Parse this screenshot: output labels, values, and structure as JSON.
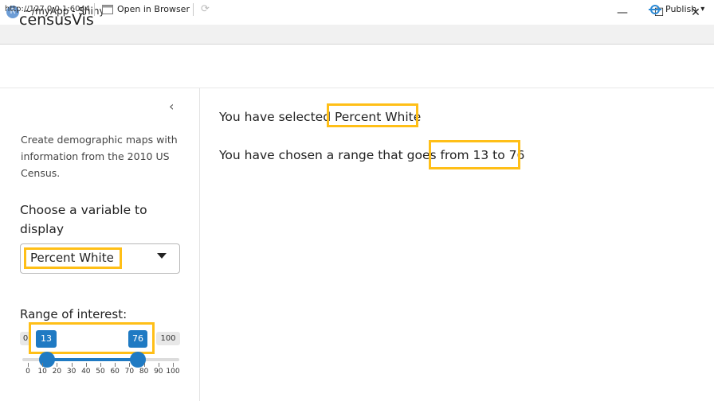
{
  "window": {
    "icon_letter": "R",
    "title": "~/myApp - Shiny",
    "minimize_glyph": "—",
    "maximize_glyph": "☐",
    "close_glyph": "✕"
  },
  "toolbar": {
    "url": "http://127.0.0.1:6044",
    "open_in_browser": "Open in Browser",
    "publish": "Publish",
    "publish_caret": "▾"
  },
  "app": {
    "title": "censusVis"
  },
  "sidebar": {
    "collapse_glyph": "‹",
    "description": "Create demographic maps with information from the 2010 US Census.",
    "select_label": "Choose a variable to display",
    "select_value": "Percent White",
    "range_label": "Range of interest:",
    "range_min_label": "0",
    "range_max_label": "100",
    "range_low": "13",
    "range_high": "76",
    "range_low_value": 13,
    "range_high_value": 76,
    "ticks": [
      "0",
      "10",
      "20",
      "30",
      "40",
      "50",
      "60",
      "70",
      "80",
      "90",
      "100"
    ]
  },
  "main": {
    "selected_prefix": "You have selected",
    "selected_value": "Percent White",
    "range_prefix": "You have chosen a range that goes",
    "range_value": "from 13 to 76"
  },
  "colors": {
    "accent": "#1f7ac3",
    "highlight": "#ffbf17"
  },
  "icons": {
    "app": "r-logo-icon",
    "open_in_browser": "browser-icon",
    "refresh": "refresh-icon",
    "publish": "publish-icon",
    "collapse": "chevron-left-icon",
    "select_caret": "caret-down-icon"
  }
}
